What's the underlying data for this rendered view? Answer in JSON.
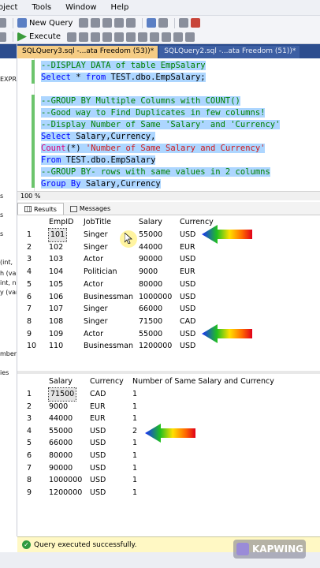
{
  "menubar": {
    "items": [
      "oject",
      "Tools",
      "Window",
      "Help"
    ]
  },
  "toolbar": {
    "new_query_label": "New Query",
    "execute_label": "Execute"
  },
  "left_pane": {
    "lines": [
      "EXPR",
      "s",
      "s",
      "s",
      "(int,",
      "h (var",
      "int, n",
      "y (var",
      "mber",
      "ies"
    ]
  },
  "doc_tabs": [
    {
      "label": "SQLQuery3.sql -...ata Freedom (53))*",
      "active": true
    },
    {
      "label": "SQLQuery2.sql -...ata Freedom (51))*",
      "active": false
    }
  ],
  "editor": {
    "line1": "--DISPLAY DATA of table EmpSalary",
    "line2_kw": "Select",
    "line2_star": " * ",
    "line2_from": "from",
    "line2_rest": " TEST.dbo.EmpSalary;",
    "line4": "--GROUP BY Multiple Columns with COUNT()",
    "line5": "--Good way to Find Duplicates in few columns!",
    "line6": "--Display Number of Same 'Salary' and 'Currency'",
    "line7_kw": "Select",
    "line7_rest": " Salary,Currency,",
    "line8_fn": "Count",
    "line8_args": "(*)",
    "line8_str": " 'Number of Same Salary and Currency'",
    "line9_kw": "From",
    "line9_rest": " TEST.dbo.EmpSalary",
    "line10": "--GROUP BY- rows with same values in 2 columns",
    "line11_kw": "Group By",
    "line11_rest": " Salary,Currency"
  },
  "zoom": "100 %",
  "results_tabs": {
    "results": "Results",
    "messages": "Messages"
  },
  "grid1": {
    "columns": [
      "EmpID",
      "JobTitle",
      "Salary",
      "Currency"
    ],
    "rows": [
      [
        "1",
        "101",
        "Singer",
        "55000",
        "USD"
      ],
      [
        "2",
        "102",
        "Singer",
        "44000",
        "EUR"
      ],
      [
        "3",
        "103",
        "Actor",
        "90000",
        "USD"
      ],
      [
        "4",
        "104",
        "Politician",
        "9000",
        "EUR"
      ],
      [
        "5",
        "105",
        "Actor",
        "80000",
        "USD"
      ],
      [
        "6",
        "106",
        "Businessman",
        "1000000",
        "USD"
      ],
      [
        "7",
        "107",
        "Singer",
        "66000",
        "USD"
      ],
      [
        "8",
        "108",
        "Singer",
        "71500",
        "CAD"
      ],
      [
        "9",
        "109",
        "Actor",
        "55000",
        "USD"
      ],
      [
        "10",
        "110",
        "Businessman",
        "1200000",
        "USD"
      ]
    ]
  },
  "grid2": {
    "columns": [
      "Salary",
      "Currency",
      "Number of Same Salary and Currency"
    ],
    "rows": [
      [
        "1",
        "71500",
        "CAD",
        "1"
      ],
      [
        "2",
        "9000",
        "EUR",
        "1"
      ],
      [
        "3",
        "44000",
        "EUR",
        "1"
      ],
      [
        "4",
        "55000",
        "USD",
        "2"
      ],
      [
        "5",
        "66000",
        "USD",
        "1"
      ],
      [
        "6",
        "80000",
        "USD",
        "1"
      ],
      [
        "7",
        "90000",
        "USD",
        "1"
      ],
      [
        "8",
        "1000000",
        "USD",
        "1"
      ],
      [
        "9",
        "1200000",
        "USD",
        "1"
      ]
    ]
  },
  "status": {
    "text": "Query executed successfully."
  },
  "watermark": {
    "text": "KAPWING"
  },
  "colors": {
    "tab_active": "#f5cc84",
    "tab_strip": "#2c4d8e",
    "selection": "#add6ff",
    "status_bg": "#fff8c4"
  }
}
